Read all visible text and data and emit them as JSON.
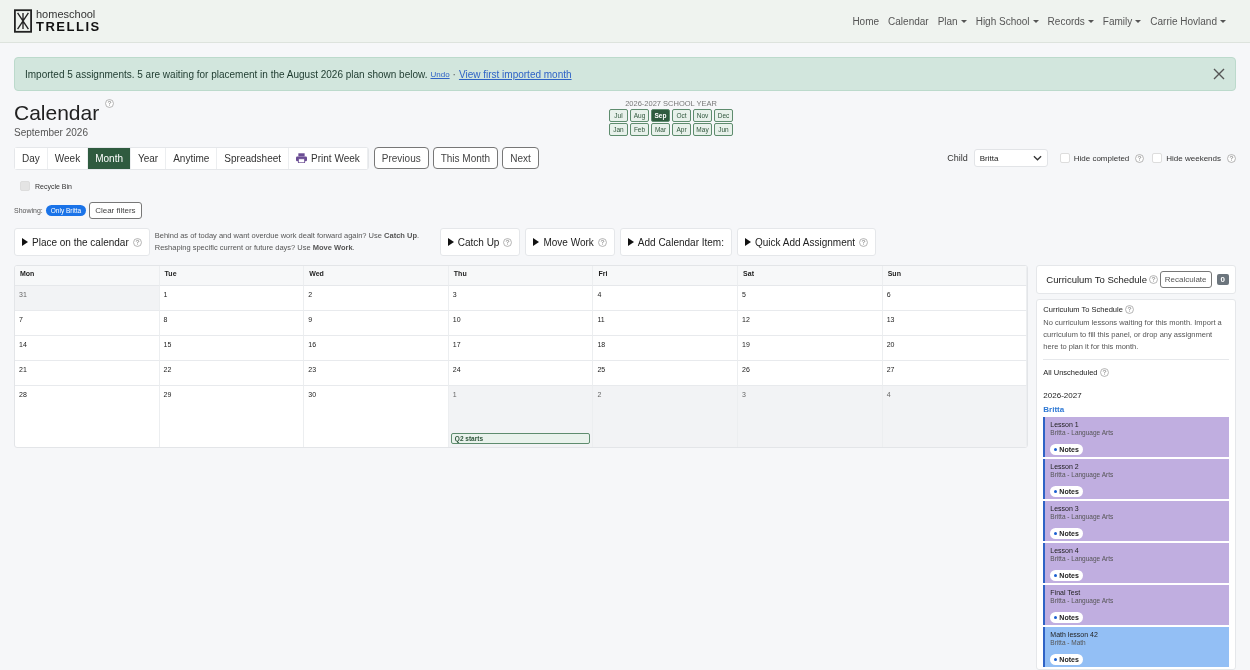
{
  "nav": {
    "brand_top": "homeschool",
    "brand_bottom": "TRELLIS",
    "links": [
      {
        "label": "Home",
        "dropdown": false
      },
      {
        "label": "Calendar",
        "dropdown": false
      },
      {
        "label": "Plan",
        "dropdown": true
      },
      {
        "label": "High School",
        "dropdown": true
      },
      {
        "label": "Records",
        "dropdown": true
      },
      {
        "label": "Family",
        "dropdown": true
      },
      {
        "label": "Carrie Hovland",
        "dropdown": true
      }
    ]
  },
  "alert": {
    "message": "Imported 5 assignments. 5 are waiting for placement in the August 2026 plan shown below.",
    "undo": "Undo",
    "separator": "·",
    "link": "View first imported month"
  },
  "page": {
    "title": "Calendar",
    "subtitle": "September 2026"
  },
  "school_year": {
    "label": "2026-2027 SCHOOL YEAR",
    "rows": [
      [
        {
          "label": "Jul",
          "selected": false
        },
        {
          "label": "Aug",
          "selected": false
        },
        {
          "label": "Sep",
          "selected": true
        },
        {
          "label": "Oct",
          "selected": false
        },
        {
          "label": "Nov",
          "selected": false
        },
        {
          "label": "Dec",
          "selected": false
        }
      ],
      [
        {
          "label": "Jan",
          "selected": false
        },
        {
          "label": "Feb",
          "selected": false
        },
        {
          "label": "Mar",
          "selected": false
        },
        {
          "label": "Apr",
          "selected": false
        },
        {
          "label": "May",
          "selected": false
        },
        {
          "label": "Jun",
          "selected": false
        }
      ]
    ]
  },
  "views": [
    {
      "label": "Day",
      "selected": false,
      "kind": "view"
    },
    {
      "label": "Week",
      "selected": false,
      "kind": "view"
    },
    {
      "label": "Month",
      "selected": true,
      "kind": "view"
    },
    {
      "label": "Year",
      "selected": false,
      "kind": "view"
    },
    {
      "label": "Anytime",
      "selected": false,
      "kind": "view"
    },
    {
      "label": "Spreadsheet",
      "selected": false,
      "kind": "view"
    },
    {
      "label": "Print Week",
      "selected": false,
      "kind": "print"
    }
  ],
  "nav_buttons": [
    "Previous",
    "This Month",
    "Next"
  ],
  "child": {
    "label": "Child",
    "value": "Britta"
  },
  "toggles": [
    {
      "label": "Hide completed",
      "checked": false
    },
    {
      "label": "Hide weekends",
      "checked": false
    }
  ],
  "recycle_bin": {
    "label": "Recycle Bin",
    "checked": false
  },
  "filters": {
    "label": "Showing:",
    "chip": "Only Britta",
    "clear": "Clear filters"
  },
  "actions": [
    {
      "kind": "panel",
      "label": "Place on the calendar",
      "help": true
    },
    {
      "kind": "hint",
      "text": "Behind as of today and want overdue work dealt forward again? Use **Catch Up**.\nReshaping specific current or future days? Use **Move Work**."
    },
    {
      "kind": "panel",
      "label": "Catch Up",
      "help": true
    },
    {
      "kind": "panel",
      "label": "Move Work",
      "help": true
    },
    {
      "kind": "panel",
      "label": "Add Calendar Item:",
      "help": false
    },
    {
      "kind": "panel",
      "label": "Quick Add Assignment",
      "help": true
    }
  ],
  "calendar": {
    "days": [
      "Mon",
      "Tue",
      "Wed",
      "Thu",
      "Fri",
      "Sat",
      "Sun"
    ],
    "weeks": [
      [
        {
          "day": "31",
          "outside": true
        },
        {
          "day": "1",
          "outside": false
        },
        {
          "day": "2",
          "outside": false
        },
        {
          "day": "3",
          "outside": false
        },
        {
          "day": "4",
          "outside": false
        },
        {
          "day": "5",
          "outside": false
        },
        {
          "day": "6",
          "outside": false
        }
      ],
      [
        {
          "day": "7",
          "outside": false
        },
        {
          "day": "8",
          "outside": false
        },
        {
          "day": "9",
          "outside": false
        },
        {
          "day": "10",
          "outside": false
        },
        {
          "day": "11",
          "outside": false
        },
        {
          "day": "12",
          "outside": false
        },
        {
          "day": "13",
          "outside": false
        }
      ],
      [
        {
          "day": "14",
          "outside": false
        },
        {
          "day": "15",
          "outside": false
        },
        {
          "day": "16",
          "outside": false
        },
        {
          "day": "17",
          "outside": false
        },
        {
          "day": "18",
          "outside": false
        },
        {
          "day": "19",
          "outside": false
        },
        {
          "day": "20",
          "outside": false
        }
      ],
      [
        {
          "day": "21",
          "outside": false
        },
        {
          "day": "22",
          "outside": false
        },
        {
          "day": "23",
          "outside": false
        },
        {
          "day": "24",
          "outside": false
        },
        {
          "day": "25",
          "outside": false
        },
        {
          "day": "26",
          "outside": false
        },
        {
          "day": "27",
          "outside": false
        }
      ],
      [
        {
          "day": "28",
          "outside": false
        },
        {
          "day": "29",
          "outside": false
        },
        {
          "day": "30",
          "outside": false
        },
        {
          "day": "1",
          "outside": true,
          "events": [
            "Q2 starts"
          ]
        },
        {
          "day": "2",
          "outside": true
        },
        {
          "day": "3",
          "outside": true
        },
        {
          "day": "4",
          "outside": true
        }
      ]
    ]
  },
  "sidebar": {
    "title": "Curriculum To Schedule",
    "button": "Recalculate",
    "count": "0",
    "section_title": "Curriculum To Schedule",
    "message": "No curriculum lessons waiting for this month. Import a curriculum to fill this panel, or drop any assignment here to plan it for this month.",
    "unscheduled": "All Unscheduled",
    "year": "2026-2027",
    "child": "Britta",
    "items": [
      {
        "title": "Lesson 1",
        "subtitle": "Britta - Language Arts",
        "tag": "Notes",
        "color": "#c0aee0"
      },
      {
        "title": "Lesson 2",
        "subtitle": "Britta - Language Arts",
        "tag": "Notes",
        "color": "#c0aee0"
      },
      {
        "title": "Lesson 3",
        "subtitle": "Britta - Language Arts",
        "tag": "Notes",
        "color": "#c0aee0"
      },
      {
        "title": "Lesson 4",
        "subtitle": "Britta - Language Arts",
        "tag": "Notes",
        "color": "#c0aee0"
      },
      {
        "title": "Final Test",
        "subtitle": "Britta - Language Arts",
        "tag": "Notes",
        "color": "#c0aee0"
      },
      {
        "title": "Math lesson 42",
        "subtitle": "Britta - Math",
        "tag": "Notes",
        "color": "#93bff5"
      }
    ]
  }
}
